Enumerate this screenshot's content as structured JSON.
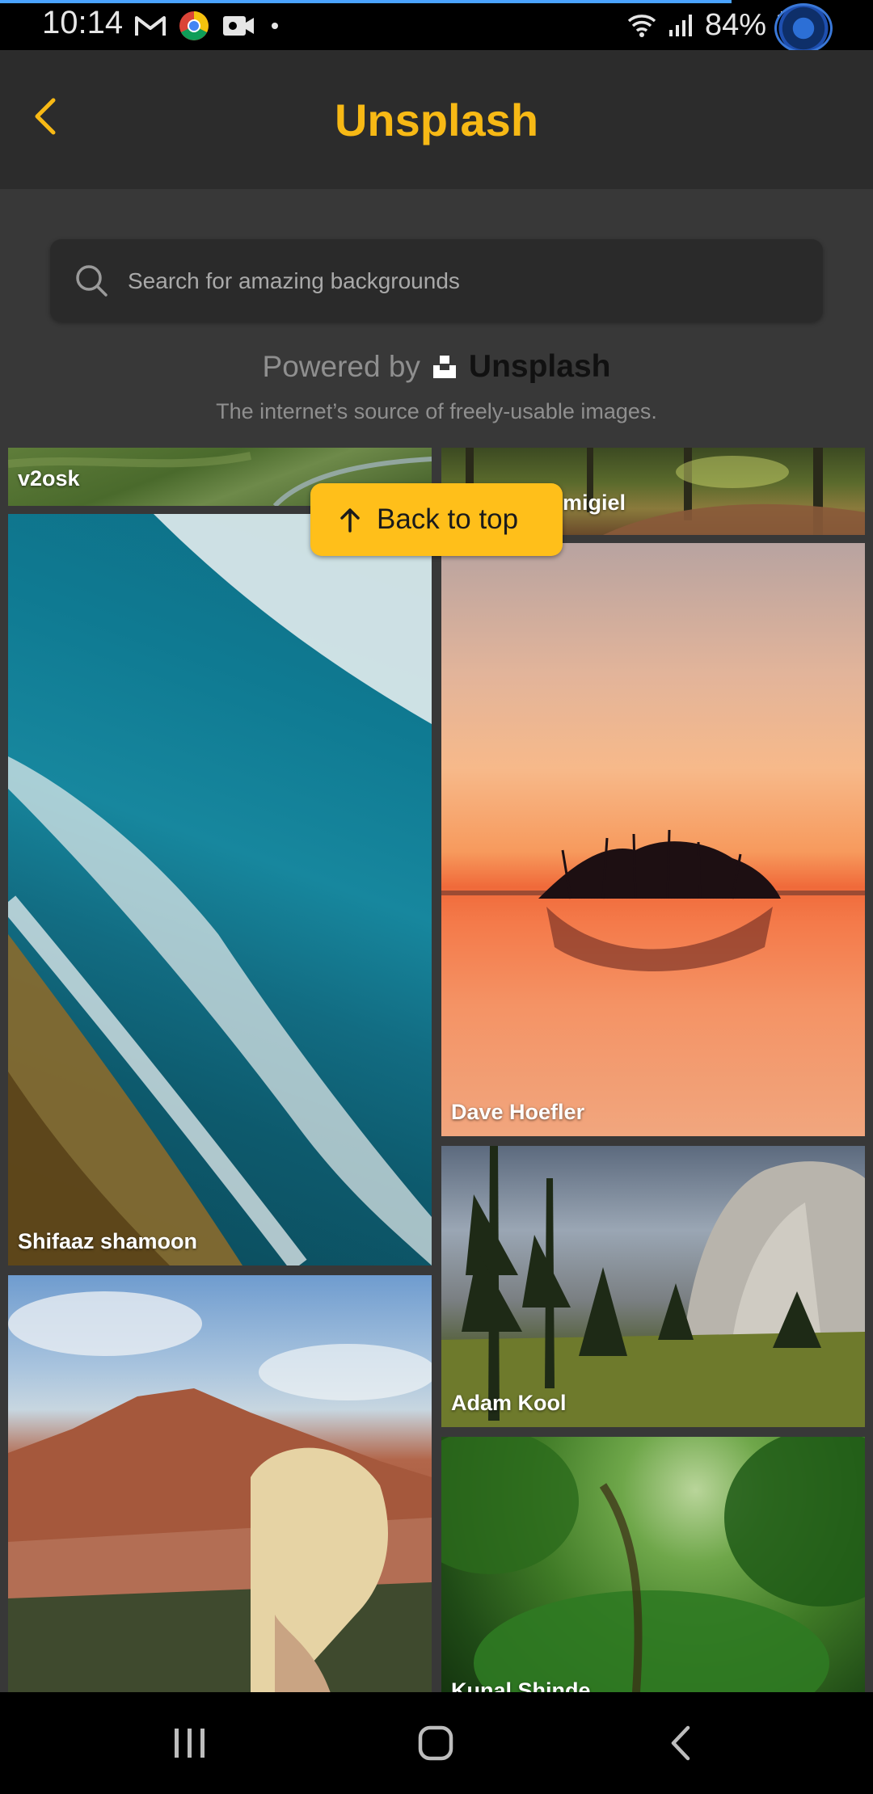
{
  "status_bar": {
    "time": "10:14",
    "battery": "84%",
    "icons": [
      "gmail-icon",
      "chrome-icon",
      "video-icon",
      "dot-icon",
      "wifi-icon",
      "signal-icon",
      "battery-icon",
      "assistant-bubble-icon"
    ]
  },
  "header": {
    "title": "Unsplash",
    "back_icon": "chevron-left-icon"
  },
  "search": {
    "placeholder": "Search for amazing backgrounds",
    "value": ""
  },
  "powered": {
    "prefix": "Powered by",
    "brand": "Unsplash",
    "tagline": "The internet’s source of freely-usable images."
  },
  "photos": {
    "v2osk": "v2osk",
    "migiel": "migiel",
    "shifaaz": "Shifaaz shamoon",
    "dave": "Dave Hoefler",
    "adam": "Adam Kool",
    "kunal": "Kunal Shinde"
  },
  "back_to_top": {
    "label": "Back to top",
    "icon": "arrow-up-icon"
  },
  "nav": {
    "recents": "recents-icon",
    "home": "home-icon",
    "back": "back-icon"
  },
  "colors": {
    "accent": "#f7b915",
    "header_bg": "#2c2c2c",
    "page_bg": "#383838"
  }
}
